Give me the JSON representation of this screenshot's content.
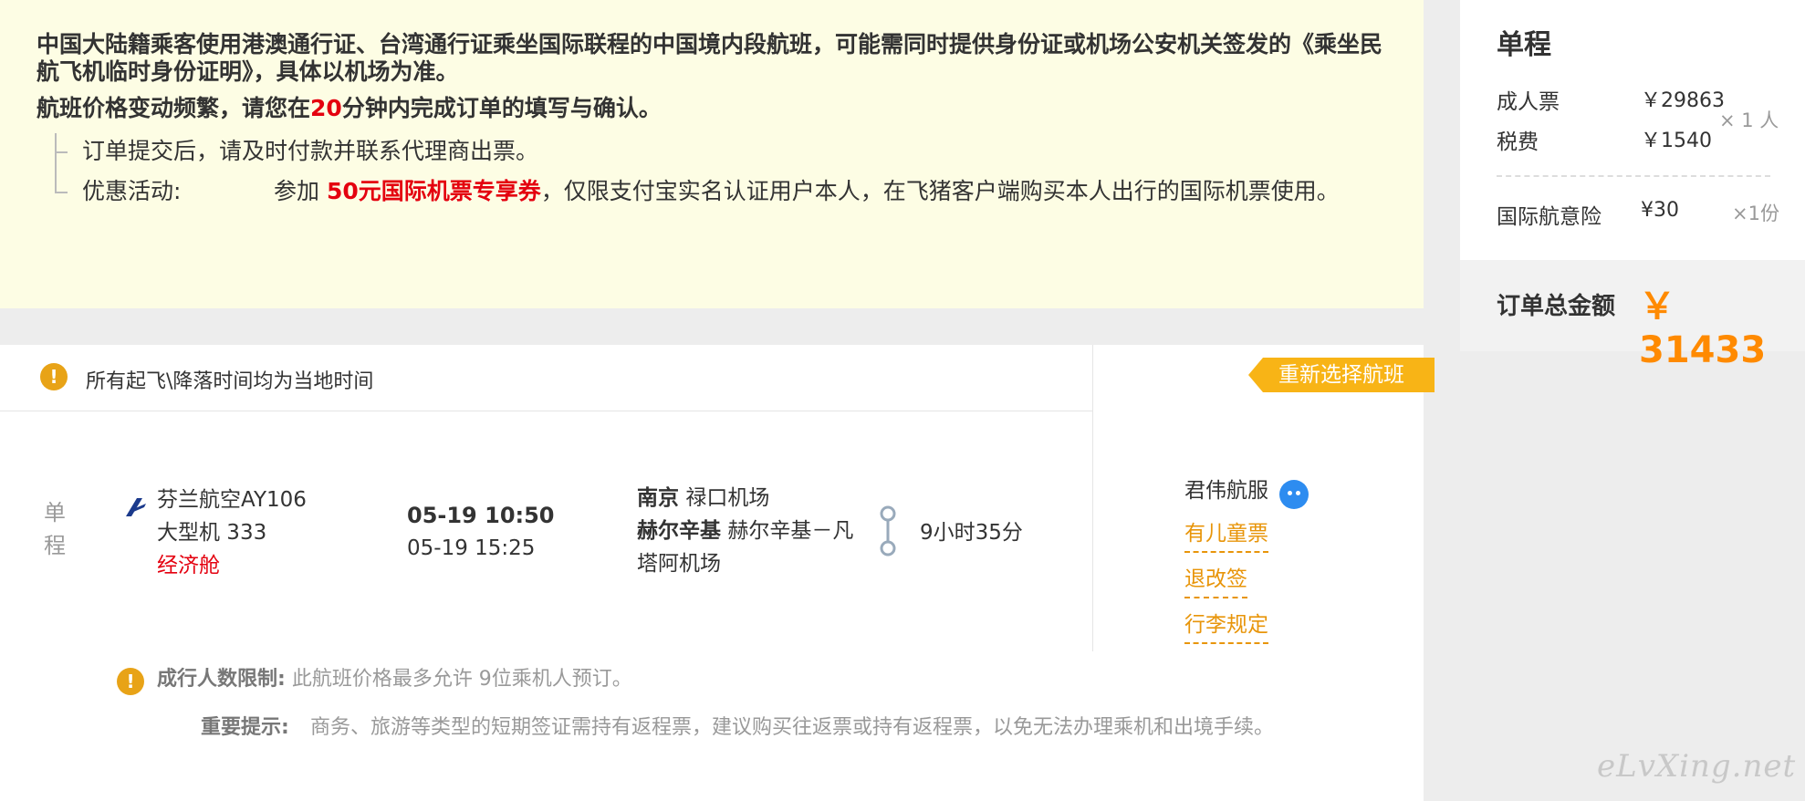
{
  "notice": {
    "line1": "中国大陆籍乘客使用港澳通行证、台湾通行证乘坐国际联程的中国境内段航班，可能需同时提供身份证或机场公安机关签发的《乘坐民航飞机临时身份证明》，具体以机场为准。",
    "line2_pre": "航班价格变动频繁，请您在",
    "line2_minutes": "20",
    "line2_post": "分钟内完成订单的填写与确认。",
    "item1": "订单提交后，请及时付款并联系代理商出票。",
    "promo_label": "优惠活动:",
    "promo_pre": "参加",
    "promo_strong": "50元国际机票专享券",
    "promo_post": "，仅限支付宝实名认证用户本人，在飞猪客户端购买本人出行的国际机票使用。"
  },
  "flight": {
    "timezone_note": "所有起飞\\降落时间均为当地时间",
    "reselect_label": "重新选择航班",
    "trip_type": "单程",
    "airline": "芬兰航空AY106",
    "aircraft": "大型机 333",
    "cabin": "经济舱",
    "dep_time": "05-19 10:50",
    "arr_time": "05-19 15:25",
    "dep_city": "南京",
    "dep_airport": "禄口机场",
    "arr_city": "赫尔辛基",
    "arr_airport": "赫尔辛基－凡塔阿机场",
    "duration": "9小时35分",
    "agent": "君伟航服",
    "link_child": "有儿童票",
    "link_refund": "退改签",
    "link_baggage": "行李规定"
  },
  "notes": {
    "limit_label": "成行人数限制:",
    "limit_text": "此航班价格最多允许 9位乘机人预订。",
    "important_label": "重要提示:",
    "important_text": "商务、旅游等类型的短期签证需持有返程票，建议购买往返票或持有返程票，以免无法办理乘机和出境手续。"
  },
  "summary": {
    "title": "单程",
    "adult_label": "成人票",
    "adult_price": "￥29863",
    "tax_label": "税费",
    "tax_price": "￥1540",
    "pax_qty": "× 1 人",
    "insurance_label": "国际航意险",
    "insurance_price": "¥30",
    "insurance_qty": "×1份",
    "total_label": "订单总金额",
    "total_value": "￥ 31433"
  },
  "watermark": "eLvXing.net",
  "colors": {
    "accent": "#ff8a00",
    "red": "#e4000f",
    "link": "#e8950a",
    "notice_bg": "#fdfde4",
    "button": "#f8b416"
  }
}
